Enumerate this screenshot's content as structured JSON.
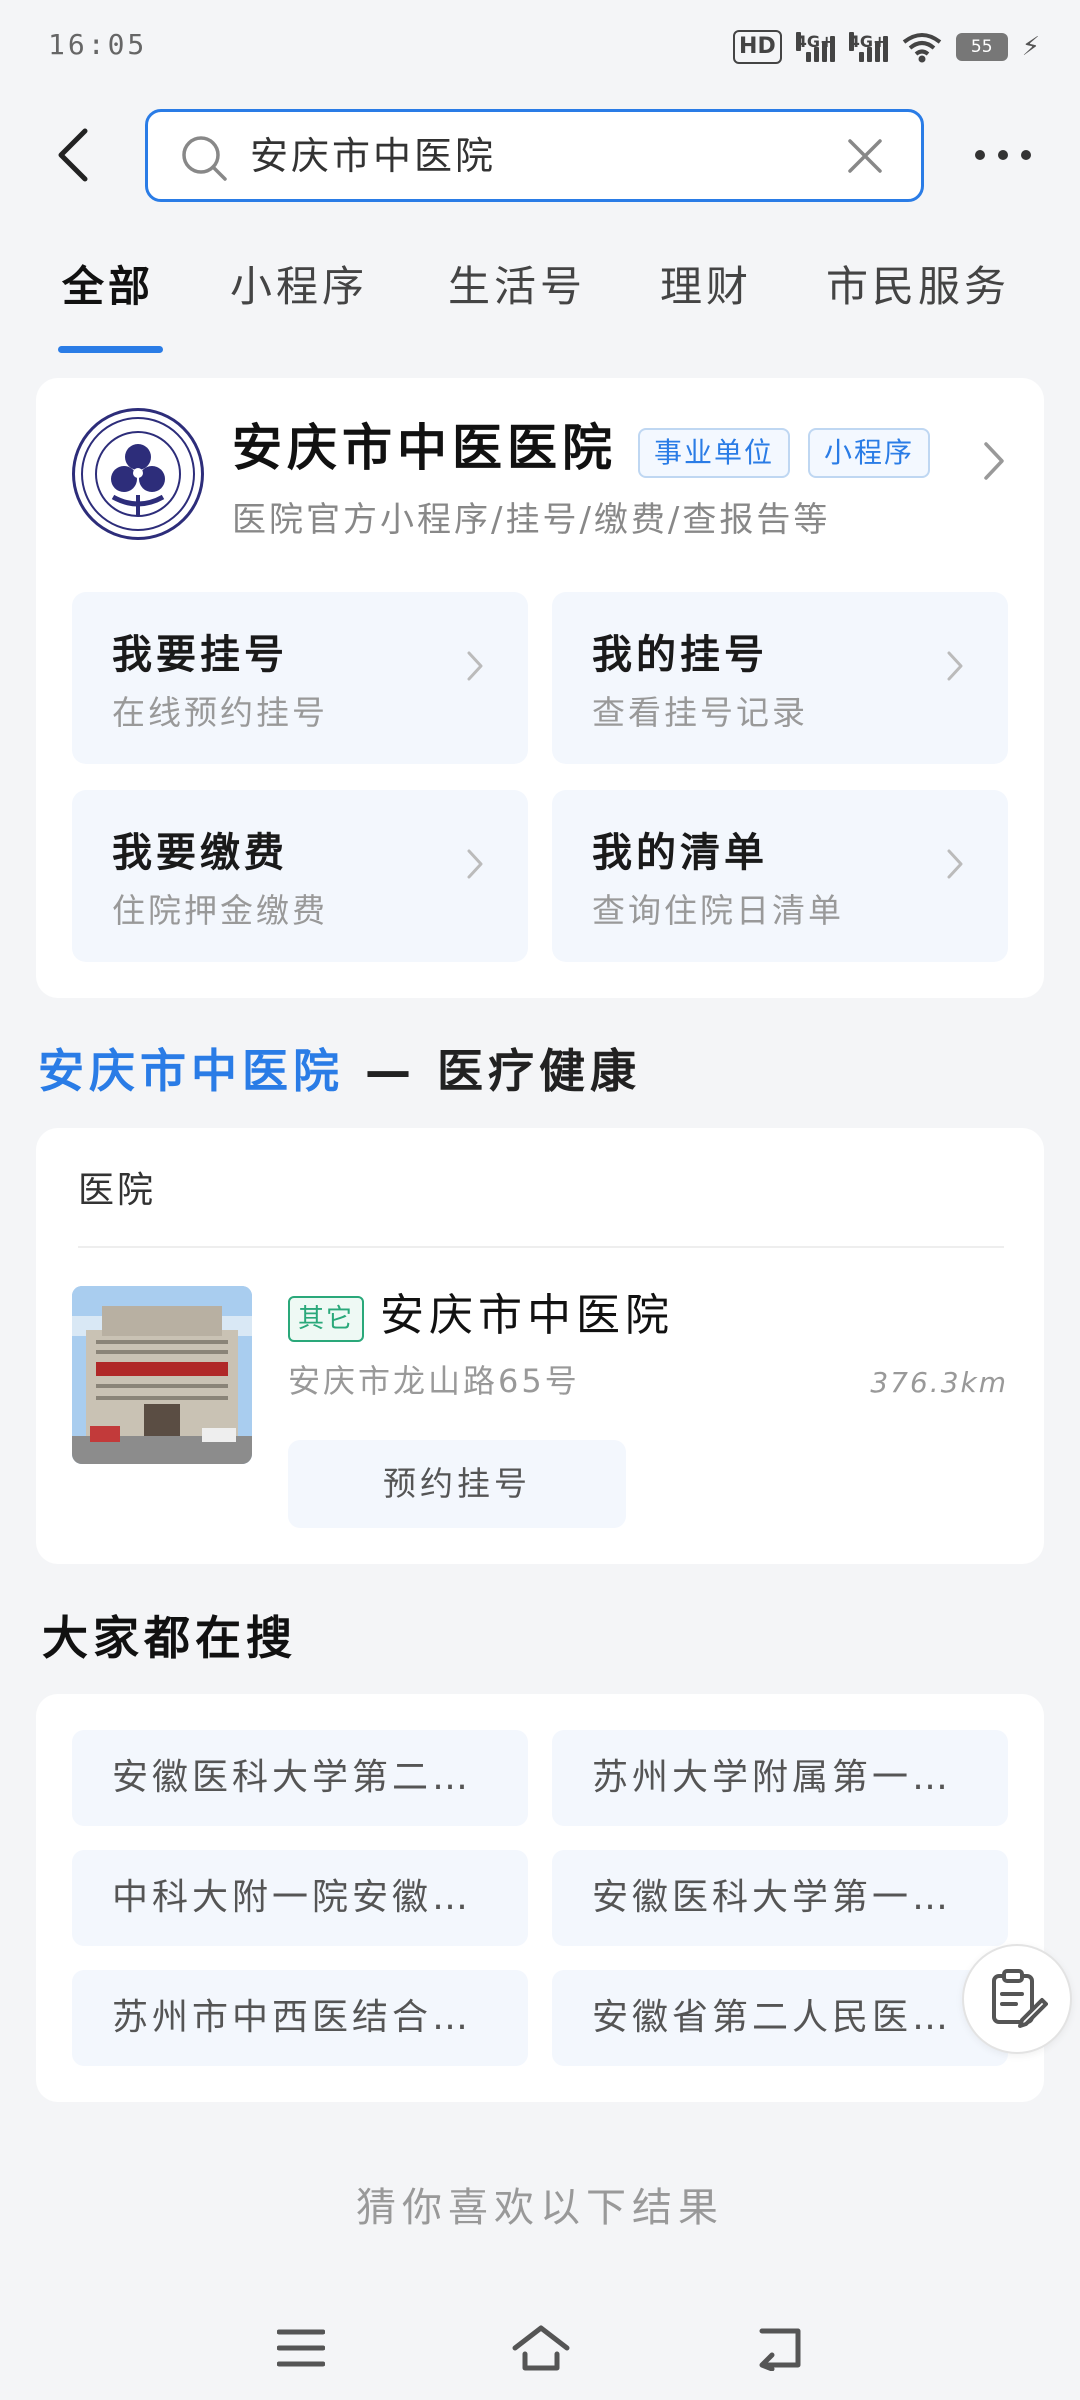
{
  "status_bar": {
    "time": "16:05",
    "network_hd": "HD",
    "signal_1_label": "4G+",
    "signal_2_label": "4G+",
    "battery": "55",
    "icons": [
      "hd-icon",
      "signal-icon",
      "signal-icon",
      "wifi-icon",
      "battery-icon",
      "charging-icon"
    ]
  },
  "search": {
    "query": "安庆市中医院",
    "icons": {
      "back": "chevron-left-icon",
      "search": "search-icon",
      "clear": "close-icon",
      "more": "more-dots-icon"
    }
  },
  "tabs": [
    {
      "label": "全部",
      "active": true
    },
    {
      "label": "小程序",
      "active": false
    },
    {
      "label": "生活号",
      "active": false
    },
    {
      "label": "理财",
      "active": false
    },
    {
      "label": "市民服务",
      "active": false
    }
  ],
  "main_card": {
    "name": "安庆市中医医院",
    "badges": [
      "事业单位",
      "小程序"
    ],
    "description": "医院官方小程序/挂号/缴费/查报告等",
    "services": [
      {
        "title": "我要挂号",
        "subtitle": "在线预约挂号"
      },
      {
        "title": "我的挂号",
        "subtitle": "查看挂号记录"
      },
      {
        "title": "我要缴费",
        "subtitle": "住院押金缴费"
      },
      {
        "title": "我的清单",
        "subtitle": "查询住院日清单"
      }
    ]
  },
  "section": {
    "highlight": "安庆市中医院",
    "separator": " — ",
    "category": "医疗健康"
  },
  "hospital_card": {
    "category": "医院",
    "tag": "其它",
    "name": "安庆市中医院",
    "address": "安庆市龙山路65号",
    "distance": "376.3km",
    "action": "预约挂号"
  },
  "popular": {
    "title": "大家都在搜",
    "items": [
      "安徽医科大学第二…",
      "苏州大学附属第一…",
      "中科大附一院安徽…",
      "安徽医科大学第一…",
      "苏州市中西医结合…",
      "安徽省第二人民医…"
    ]
  },
  "guess_text": "猜你喜欢以下结果",
  "colors": {
    "accent": "#2a7ce6",
    "background": "#f4f5f7",
    "tag_green": "#2aa87a",
    "service_bg": "#f3f7fd"
  }
}
